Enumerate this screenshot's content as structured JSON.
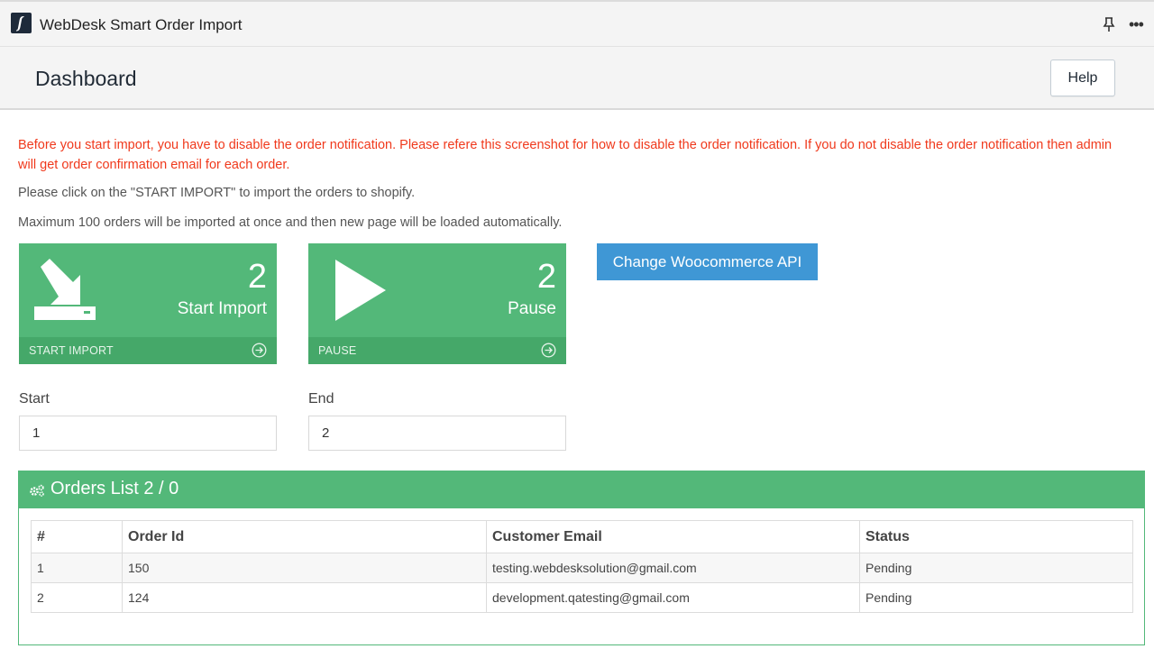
{
  "app": {
    "title": "WebDesk Smart Order Import",
    "logo_icon": "webdesk-logo-icon"
  },
  "header": {
    "title": "Dashboard",
    "help_label": "Help"
  },
  "notice": {
    "warning": "Before you start import, you have to disable the order notification. Please refere this screenshot for how to disable the order notification. If you do not disable the order notification then admin will get order confirmation email for each order.",
    "info_start": "Please click on the \"START IMPORT\" to import the orders to shopify.",
    "info_max": "Maximum 100 orders will be imported at once and then new page will be loaded automatically."
  },
  "tiles": {
    "start_import": {
      "count": "2",
      "label": "Start Import",
      "footer": "START IMPORT",
      "icon": "import-arrow-icon"
    },
    "pause": {
      "count": "2",
      "label": "Pause",
      "footer": "PAUSE",
      "icon": "play-icon"
    }
  },
  "api_button_label": "Change Woocommerce API",
  "range": {
    "start_label": "Start",
    "start_value": "1",
    "end_label": "End",
    "end_value": "2"
  },
  "orders": {
    "title": "Orders List 2 / 0",
    "columns": [
      "#",
      "Order Id",
      "Customer Email",
      "Status"
    ],
    "rows": [
      [
        "1",
        "150",
        "testing.webdesksolution@gmail.com",
        "Pending"
      ],
      [
        "2",
        "124",
        "development.qatesting@gmail.com",
        "Pending"
      ]
    ]
  },
  "colors": {
    "tile_green": "#53b879",
    "tile_footer": "#45a869",
    "api_blue": "#3f97d5",
    "warning_red": "#f0391c"
  }
}
